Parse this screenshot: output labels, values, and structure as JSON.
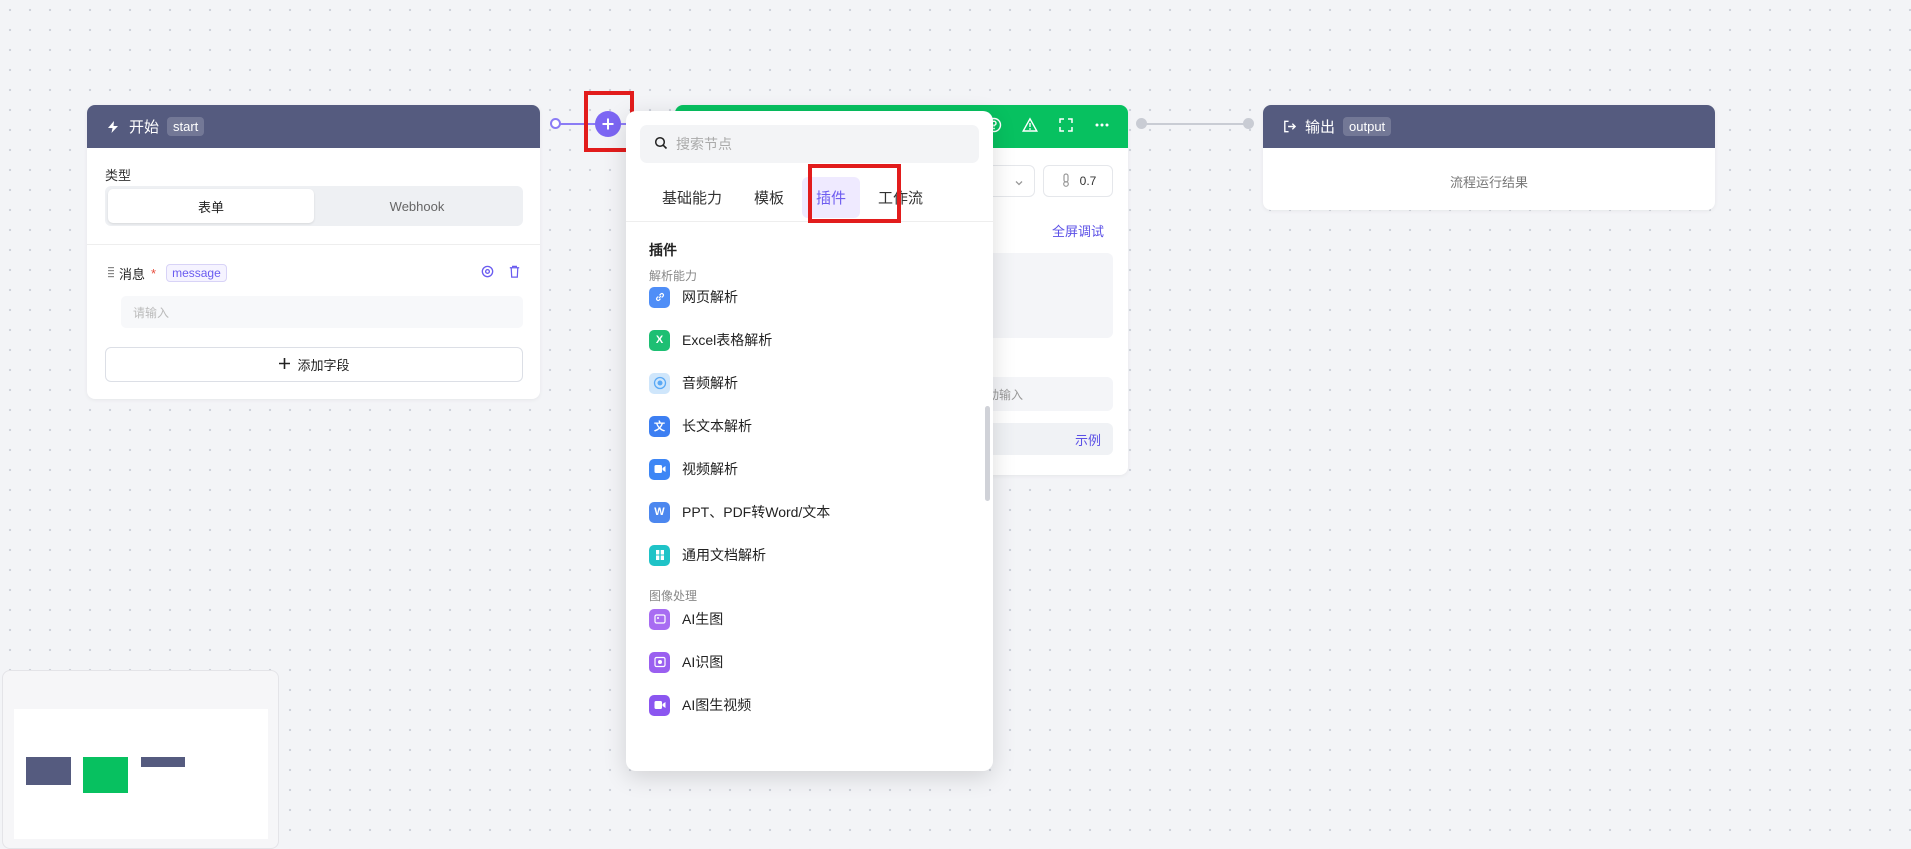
{
  "start_node": {
    "title": "开始",
    "tag": "start",
    "type_label": "类型",
    "type_options": [
      "表单",
      "Webhook"
    ],
    "selected_type": "表单",
    "field": {
      "label": "消息",
      "required_mark": "*",
      "variable": "message",
      "placeholder": "请输入"
    },
    "add_field_label": "添加字段"
  },
  "middle_node": {
    "temperature": "0.7",
    "debug_label": "全屏调试",
    "input_placeholder": "动输入",
    "example_label": "示例",
    "header_icons": [
      "help-icon",
      "warning-icon",
      "fullscreen-icon",
      "more-icon"
    ]
  },
  "output_node": {
    "title": "输出",
    "tag": "output",
    "result_text": "流程运行结果"
  },
  "node_picker": {
    "search_placeholder": "搜索节点",
    "tabs": [
      "基础能力",
      "模板",
      "插件",
      "工作流"
    ],
    "active_tab": "插件",
    "section_title": "插件",
    "groups": [
      {
        "name": "解析能力",
        "items": [
          {
            "label": "网页解析",
            "icon": "link-icon",
            "color": "#4f8ef7"
          },
          {
            "label": "Excel表格解析",
            "icon": "excel-icon",
            "color": "#1dbf73"
          },
          {
            "label": "音频解析",
            "icon": "audio-icon",
            "color": "#5aa9f5"
          },
          {
            "label": "长文本解析",
            "icon": "long-text-icon",
            "color": "#3d7ff2"
          },
          {
            "label": "视频解析",
            "icon": "video-icon",
            "color": "#3d86f5"
          },
          {
            "label": "PPT、PDF转Word/文本",
            "icon": "word-convert-icon",
            "color": "#4c87ef"
          },
          {
            "label": "通用文档解析",
            "icon": "document-icon",
            "color": "#1fc3c7"
          }
        ]
      },
      {
        "name": "图像处理",
        "items": [
          {
            "label": "AI生图",
            "icon": "ai-image-gen-icon",
            "color": "#a86cf2"
          },
          {
            "label": "AI识图",
            "icon": "ai-image-recognition-icon",
            "color": "#9a5ff0"
          },
          {
            "label": "AI图生视频",
            "icon": "ai-image-to-video-icon",
            "color": "#8b56f0"
          }
        ]
      }
    ]
  },
  "colors": {
    "node_header": "#555b7f",
    "llm_header": "#07c160",
    "accent": "#7c66f3",
    "highlight": "#e21c1c"
  }
}
